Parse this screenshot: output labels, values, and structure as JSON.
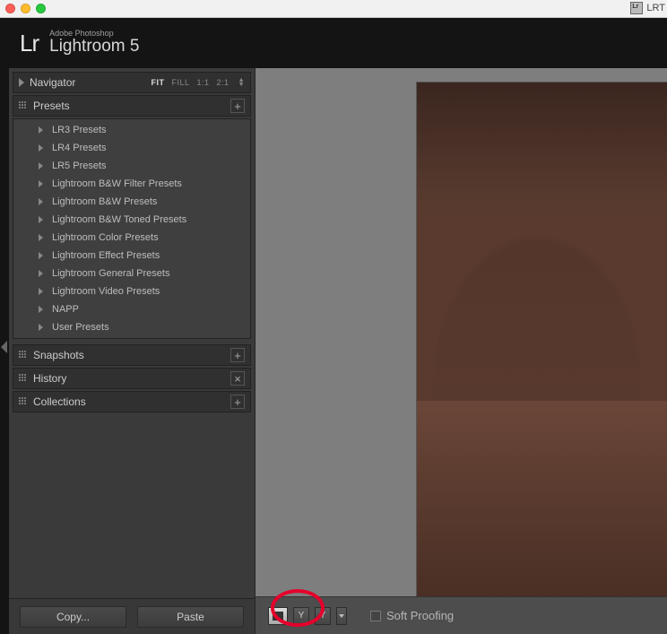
{
  "titlebar": {
    "right_label": "LRT"
  },
  "header": {
    "brand_top": "Adobe Photoshop",
    "brand_bottom": "Lightroom 5",
    "logo": "Lr"
  },
  "panels": {
    "navigator": {
      "title": "Navigator",
      "zoom": {
        "fit": "FIT",
        "fill": "FILL",
        "one": "1:1",
        "two": "2:1"
      }
    },
    "presets": {
      "title": "Presets",
      "add_label": "+",
      "items": [
        "LR3 Presets",
        "LR4 Presets",
        "LR5 Presets",
        "Lightroom B&W Filter Presets",
        "Lightroom B&W Presets",
        "Lightroom B&W Toned Presets",
        "Lightroom Color Presets",
        "Lightroom Effect Presets",
        "Lightroom General Presets",
        "Lightroom Video Presets",
        "NAPP",
        "User Presets"
      ]
    },
    "snapshots": {
      "title": "Snapshots",
      "add_label": "+"
    },
    "history": {
      "title": "History",
      "close_label": "×"
    },
    "collections": {
      "title": "Collections",
      "add_label": "+"
    }
  },
  "buttons": {
    "copy": "Copy...",
    "paste": "Paste"
  },
  "toolbar": {
    "loupe_label": "",
    "compare_y1": "Y",
    "compare_y2": "Y",
    "softproof": "Soft Proofing"
  }
}
